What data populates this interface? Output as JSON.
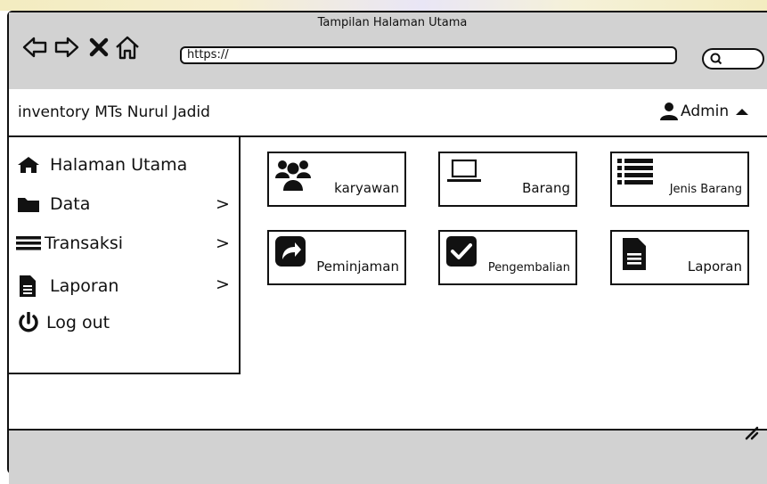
{
  "window": {
    "title": "Tampilan Halaman Utama"
  },
  "navigation": {
    "back_icon": "back-arrow-icon",
    "forward_icon": "forward-arrow-icon",
    "close_icon": "close-x-icon",
    "home_icon": "home-outline-icon",
    "address_value": "https://",
    "search_icon": "search-icon"
  },
  "app": {
    "name": "inventory MTs Nurul Jadid",
    "user_label": "Admin",
    "user_icon": "user-icon",
    "caret_icon": "caret-up-icon"
  },
  "sidebar": {
    "items": [
      {
        "label": "Halaman Utama",
        "icon": "home-icon",
        "has_submenu": false
      },
      {
        "label": "Data",
        "icon": "folder-icon",
        "has_submenu": true
      },
      {
        "label": "Transaksi",
        "icon": "list-bars-icon",
        "has_submenu": true
      },
      {
        "label": "Laporan",
        "icon": "file-icon",
        "has_submenu": true
      },
      {
        "label": "Log out",
        "icon": "power-icon",
        "has_submenu": false
      }
    ],
    "chevron": ">"
  },
  "tiles": [
    {
      "label": "karyawan",
      "icon": "users-icon"
    },
    {
      "label": "Barang",
      "icon": "laptop-icon"
    },
    {
      "label": "Jenis Barang",
      "icon": "list-icon"
    },
    {
      "label": "Peminjaman",
      "icon": "share-icon"
    },
    {
      "label": "Pengembalian",
      "icon": "checkbox-icon"
    },
    {
      "label": "Laporan",
      "icon": "document-icon"
    }
  ],
  "colors": {
    "chrome_gray": "#d2d2d2",
    "border": "#111111",
    "background": "#ffffff"
  }
}
